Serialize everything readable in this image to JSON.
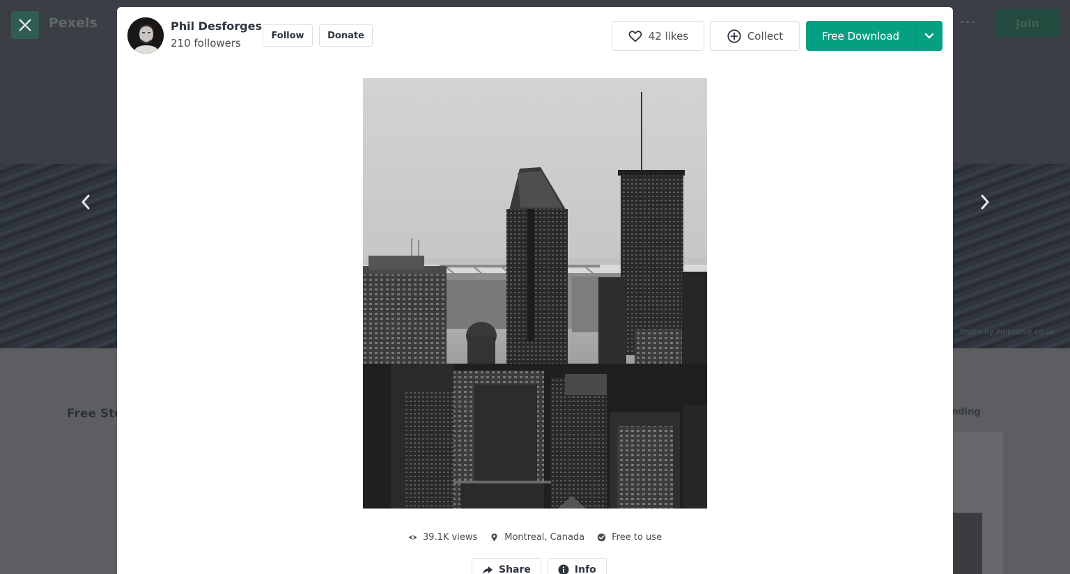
{
  "background": {
    "logo": "Pexels",
    "join_label": "Join",
    "more_dots": "···",
    "section_title": "Free Sto",
    "trending_label": "nding",
    "credit": "Photo by Pinkclove.co.uk"
  },
  "author": {
    "name": "Phil Desforges",
    "followers": "210 followers",
    "follow_label": "Follow",
    "donate_label": "Donate"
  },
  "actions": {
    "likes_label": "42 likes",
    "collect_label": "Collect",
    "download_label": "Free Download"
  },
  "meta": {
    "views": "39.1K views",
    "location": "Montreal, Canada",
    "license": "Free to use"
  },
  "footer_actions": {
    "share_label": "Share",
    "info_label": "Info"
  },
  "colors": {
    "accent": "#05a081",
    "overlay": "#5b5d60"
  },
  "icons": {
    "close": "close-icon",
    "prev": "chevron-left-icon",
    "next": "chevron-right-icon",
    "like": "heart-icon",
    "collect": "plus-circle-icon",
    "download_more": "chevron-down-icon",
    "views": "eye-icon",
    "location": "map-pin-icon",
    "license": "check-circle-icon",
    "share": "share-arrow-icon",
    "info": "info-icon"
  }
}
